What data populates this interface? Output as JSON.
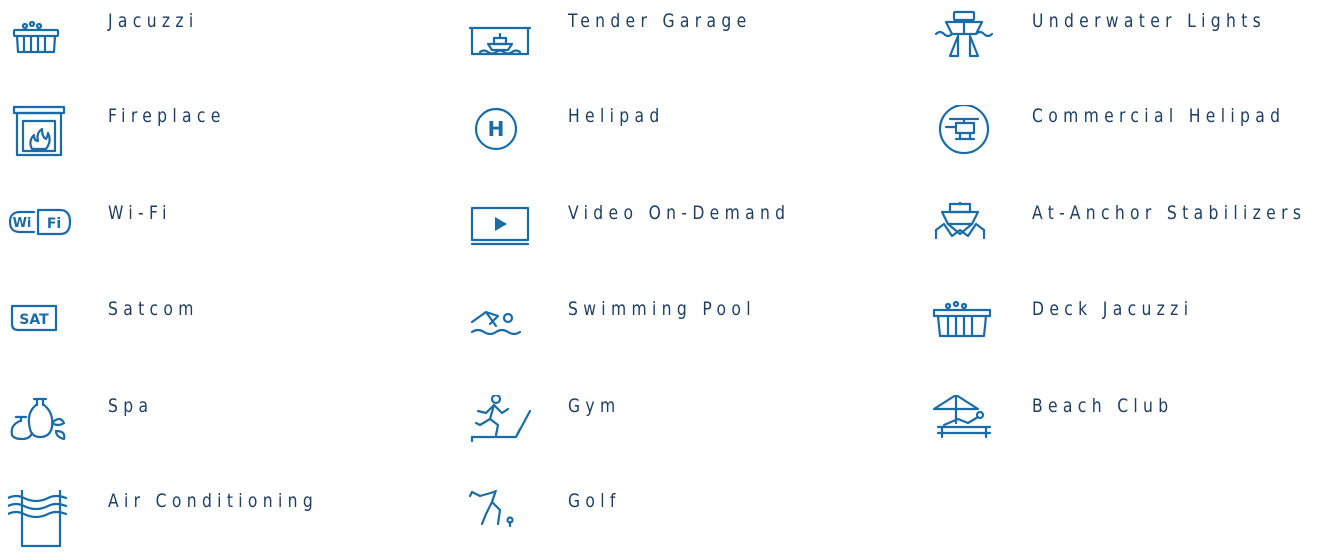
{
  "amenities": {
    "jacuzzi": "Jacuzzi",
    "tender_garage": "Tender Garage",
    "underwater_lights": "Underwater Lights",
    "fireplace": "Fireplace",
    "helipad": "Helipad",
    "commercial_helipad": "Commercial Helipad",
    "wifi": "Wi-Fi",
    "video_on_demand": "Video On-Demand",
    "at_anchor_stabilizers": "At-Anchor Stabilizers",
    "satcom": "Satcom",
    "swimming_pool": "Swimming Pool",
    "deck_jacuzzi": "Deck Jacuzzi",
    "spa": "Spa",
    "gym": "Gym",
    "beach_club": "Beach Club",
    "air_conditioning": "Air Conditioning",
    "golf": "Golf"
  },
  "icon_text": {
    "helipad": "H",
    "wifi_left": "Wi",
    "wifi_right": "Fi",
    "satcom": "SAT"
  },
  "icons": {
    "jacuzzi": "jacuzzi-icon",
    "tender_garage": "tender-garage-icon",
    "underwater_lights": "underwater-lights-icon",
    "fireplace": "fireplace-icon",
    "helipad": "helipad-icon",
    "commercial_helipad": "helicopter-icon",
    "wifi": "wifi-icon",
    "video_on_demand": "play-screen-icon",
    "at_anchor_stabilizers": "stabilizer-boat-icon",
    "satcom": "satcom-icon",
    "swimming_pool": "swimmer-icon",
    "deck_jacuzzi": "deck-jacuzzi-icon",
    "spa": "spa-icon",
    "gym": "treadmill-icon",
    "beach_club": "beach-umbrella-icon",
    "air_conditioning": "air-conditioning-icon",
    "golf": "golfer-icon"
  },
  "colors": {
    "icon": "#1a6ca8",
    "text": "#1e3e63"
  }
}
